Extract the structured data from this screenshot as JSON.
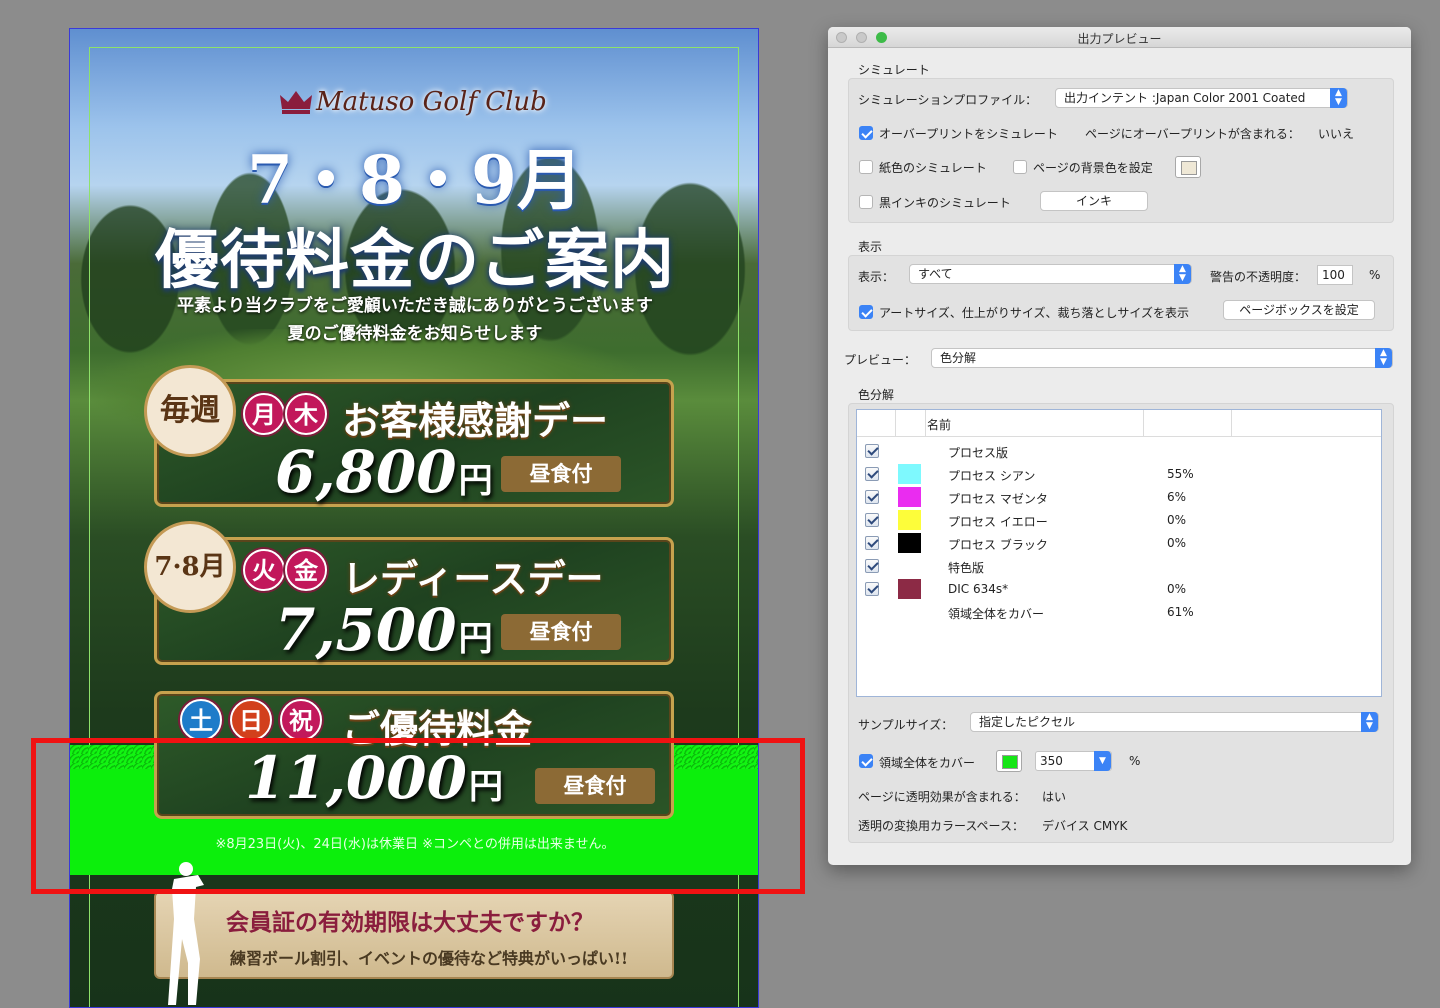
{
  "flyer": {
    "club_name": "Matuso Golf Club",
    "months": "7・8・9月",
    "title": "優待料金のご案内",
    "intro_line1": "平素より当クラブをご愛顧いただき誠にありがとうございます",
    "intro_line2": "夏のご優待料金をお知らせします",
    "offers": [
      {
        "badge": "毎週",
        "days": [
          "月",
          "木"
        ],
        "heading": "お客様感謝デー",
        "price": "6,800",
        "yen": "円",
        "lunch": "昼食付"
      },
      {
        "badge": "7·8月",
        "days": [
          "火",
          "金"
        ],
        "heading": "レディースデー",
        "price": "7,500",
        "yen": "円",
        "lunch": "昼食付"
      },
      {
        "days": [
          "土",
          "日",
          "祝"
        ],
        "heading": "ご優待料金",
        "price": "11,000",
        "yen": "円",
        "lunch": "昼食付"
      }
    ],
    "notice": "※8月23日(火)、24日(水)は休業日 ※コンペとの併用は出来ません。",
    "member_question": "会員証の有効期限は大丈夫ですか？",
    "member_sub": "練習ボール割引、イベントの優待など特典がいっぱい!!"
  },
  "panel": {
    "window_title": "出力プレビュー",
    "simulate": {
      "section": "シミュレート",
      "profile_label": "シミュレーションプロファイル：",
      "profile_value": "出力インテント :Japan Color 2001 Coated",
      "overprint_label": "オーバープリントをシミュレート",
      "overprint_checked": true,
      "page_overprint_label": "ページにオーバープリントが含まれる：",
      "page_overprint_value": "いいえ",
      "paper_label": "紙色のシミュレート",
      "paper_checked": false,
      "bg_label": "ページの背景色を設定",
      "bg_checked": false,
      "black_ink_label": "黒インキのシミュレート",
      "black_ink_checked": false,
      "ink_button": "インキ"
    },
    "display": {
      "section": "表示",
      "show_label": "表示：",
      "show_value": "すべて",
      "warn_opacity_label": "警告の不透明度：",
      "warn_opacity_value": "100",
      "percent": "%",
      "boxes_label": "アートサイズ、仕上がりサイズ、裁ち落としサイズを表示",
      "boxes_checked": true,
      "page_box_button": "ページボックスを設定"
    },
    "preview": {
      "label": "プレビュー：",
      "value": "色分解"
    },
    "separations": {
      "section": "色分解",
      "col_name": "名前",
      "rows": [
        {
          "name": "プロセス版",
          "swatch": "",
          "value": ""
        },
        {
          "name": "プロセス シアン",
          "swatch": "#7ef9fe",
          "value": "55%"
        },
        {
          "name": "プロセス マゼンタ",
          "swatch": "#ea2cf0",
          "value": "6%"
        },
        {
          "name": "プロセス イエロー",
          "swatch": "#fdfd3a",
          "value": "0%"
        },
        {
          "name": "プロセス ブラック",
          "swatch": "#000000",
          "value": "0%"
        },
        {
          "name": "特色版",
          "swatch": "",
          "value": ""
        },
        {
          "name": "DIC 634s*",
          "swatch": "#8c2a45",
          "value": "0%"
        },
        {
          "name": "領域全体をカバー",
          "swatch": "",
          "value": "61%",
          "no_checkbox": true
        }
      ]
    },
    "sample": {
      "label": "サンプルサイズ：",
      "value": "指定したピクセル"
    },
    "coverage": {
      "label": "領域全体をカバー",
      "checked": true,
      "color": "#16e516",
      "value": "350",
      "percent": "%"
    },
    "transparency_label": "ページに透明効果が含まれる：",
    "transparency_value": "はい",
    "blend_space_label": "透明の変換用カラースペース：",
    "blend_space_value": "デバイス CMYK"
  },
  "colors": {
    "highlight_frame": "#f01212",
    "accent": "#3b83f6"
  }
}
